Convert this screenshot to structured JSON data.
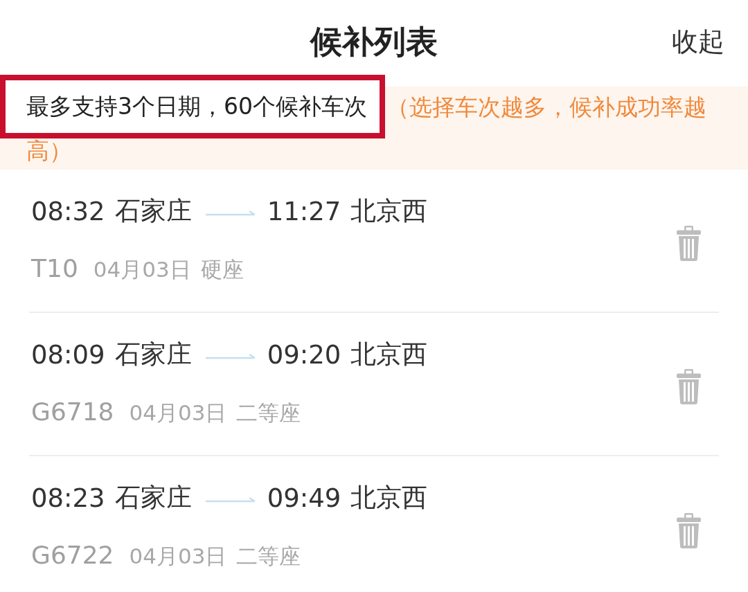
{
  "header": {
    "title": "候补列表",
    "collapse_button": "收起"
  },
  "notice": {
    "annotation": "最多支持3个日期，60个候补车次",
    "text_line_1": "（选择车次越多，候补成功率越",
    "text_line_2": "高）"
  },
  "trains": [
    {
      "depart_time": "08:32",
      "from": "石家庄",
      "arrive_time": "11:27",
      "to": "北京西",
      "train_no": "T10",
      "date": "04月03日",
      "seat": "硬座"
    },
    {
      "depart_time": "08:09",
      "from": "石家庄",
      "arrive_time": "09:20",
      "to": "北京西",
      "train_no": "G6718",
      "date": "04月03日",
      "seat": "二等座"
    },
    {
      "depart_time": "08:23",
      "from": "石家庄",
      "arrive_time": "09:49",
      "to": "北京西",
      "train_no": "G6722",
      "date": "04月03日",
      "seat": "二等座"
    }
  ]
}
